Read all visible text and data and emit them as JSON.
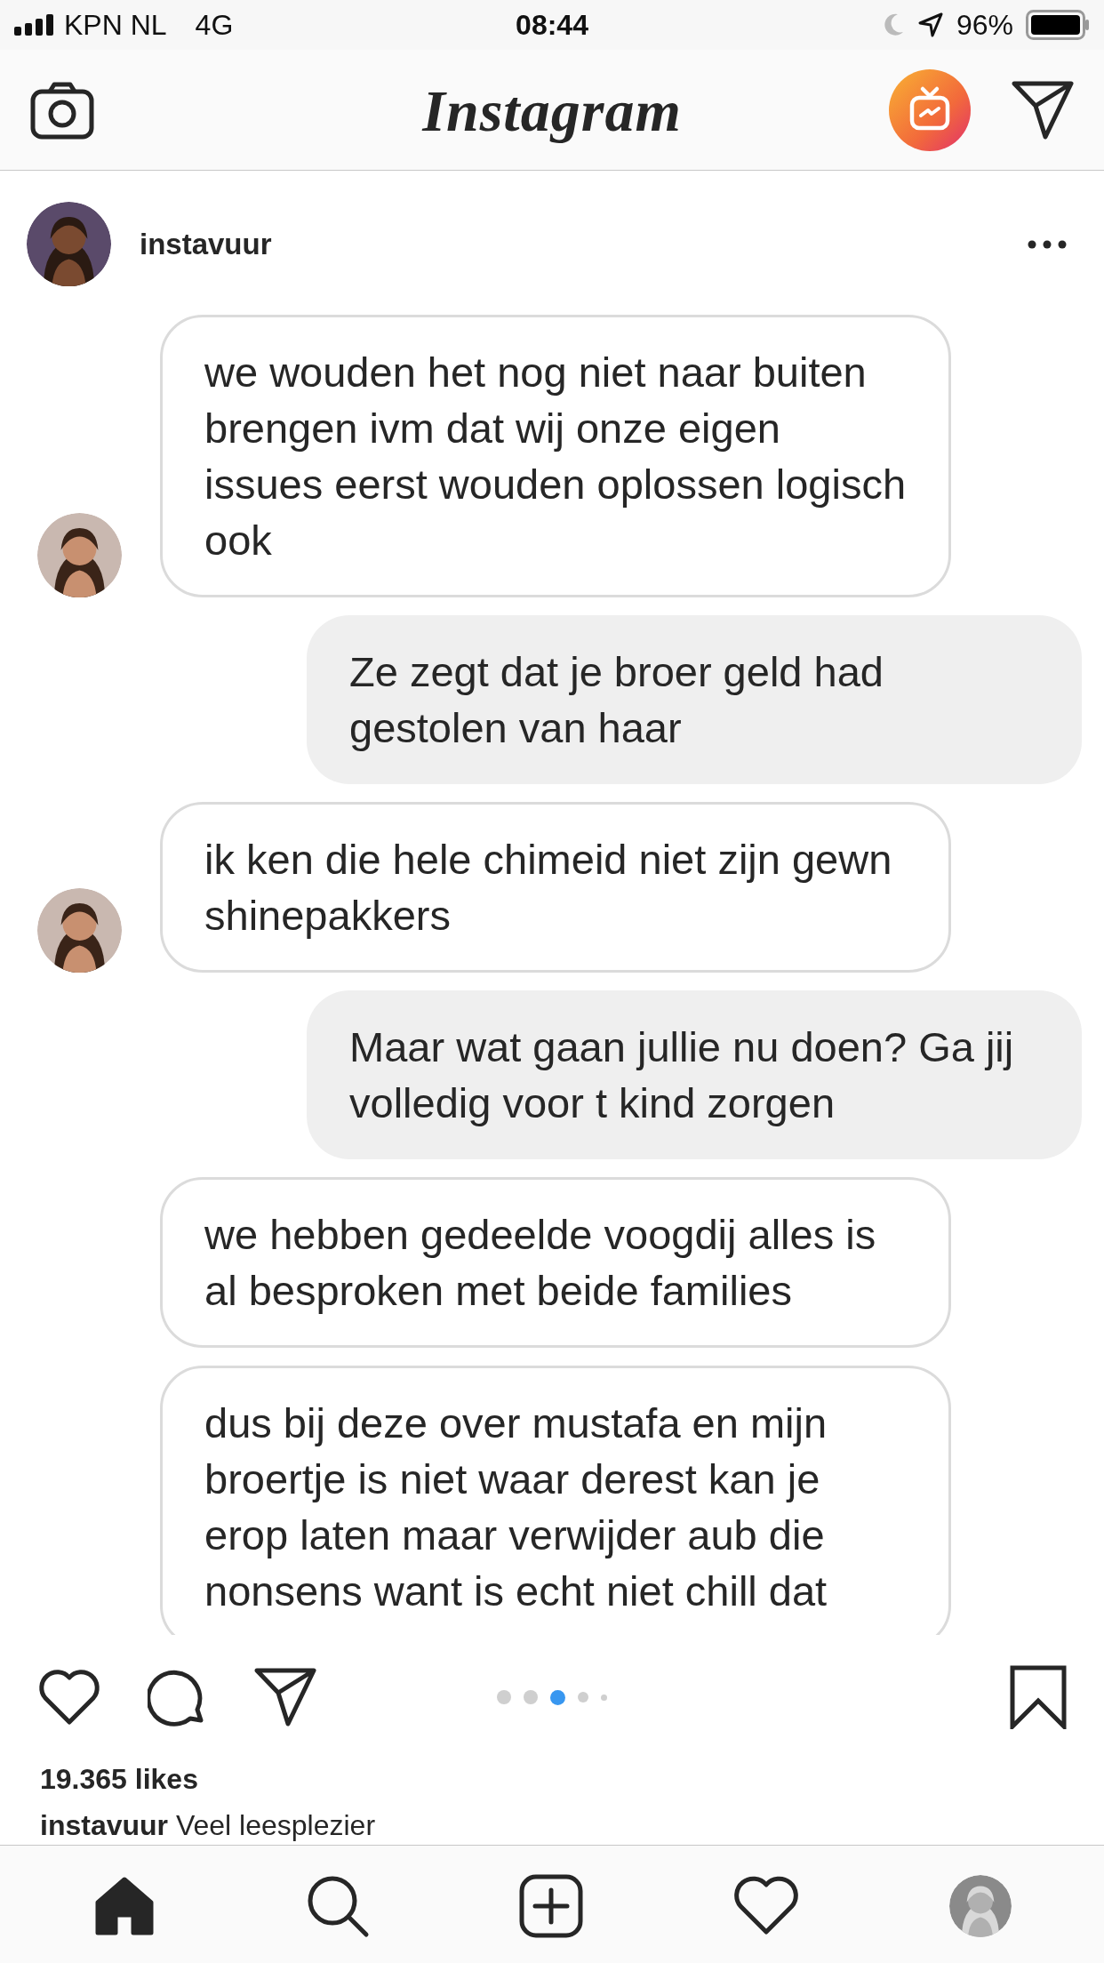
{
  "status_bar": {
    "carrier": "KPN NL",
    "network": "4G",
    "time": "08:44",
    "battery": "96%"
  },
  "header": {
    "logo": "Instagram"
  },
  "post": {
    "username": "instavuur",
    "messages": [
      {
        "kind": "received",
        "avatar": true,
        "text": "we wouden het nog niet naar buiten brengen ivm dat wij onze eigen issues eerst wouden oplossen logisch ook"
      },
      {
        "kind": "sent",
        "text": "Ze zegt dat je broer geld had gestolen van haar"
      },
      {
        "kind": "received",
        "avatar": true,
        "text": "ik ken die hele chimeid niet zijn gewn shinepakkers"
      },
      {
        "kind": "sent",
        "text": "Maar wat gaan jullie nu doen? Ga jij volledig voor t kind zorgen"
      },
      {
        "kind": "received",
        "avatar": false,
        "text": "we hebben gedeelde voogdij alles is al besproken met beide families"
      },
      {
        "kind": "received",
        "avatar": false,
        "text": "dus bij deze over mustafa en mijn broertje is niet waar derest kan je erop laten maar verwijder aub die nonsens want is echt niet chill dat"
      }
    ],
    "carousel": [
      {
        "selected": false
      },
      {
        "selected": false
      },
      {
        "selected": true
      },
      {
        "selected": false
      },
      {
        "selected": false
      }
    ],
    "likes": "19.365 likes",
    "caption": "**instavuur** Veel leesplezier"
  },
  "tab_bar": [
    {
      "kind": "home",
      "selected": true
    },
    {
      "kind": "search",
      "selected": false
    },
    {
      "kind": "add",
      "selected": false
    },
    {
      "kind": "activity",
      "selected": false
    },
    {
      "kind": "profile",
      "selected": false
    }
  ]
}
